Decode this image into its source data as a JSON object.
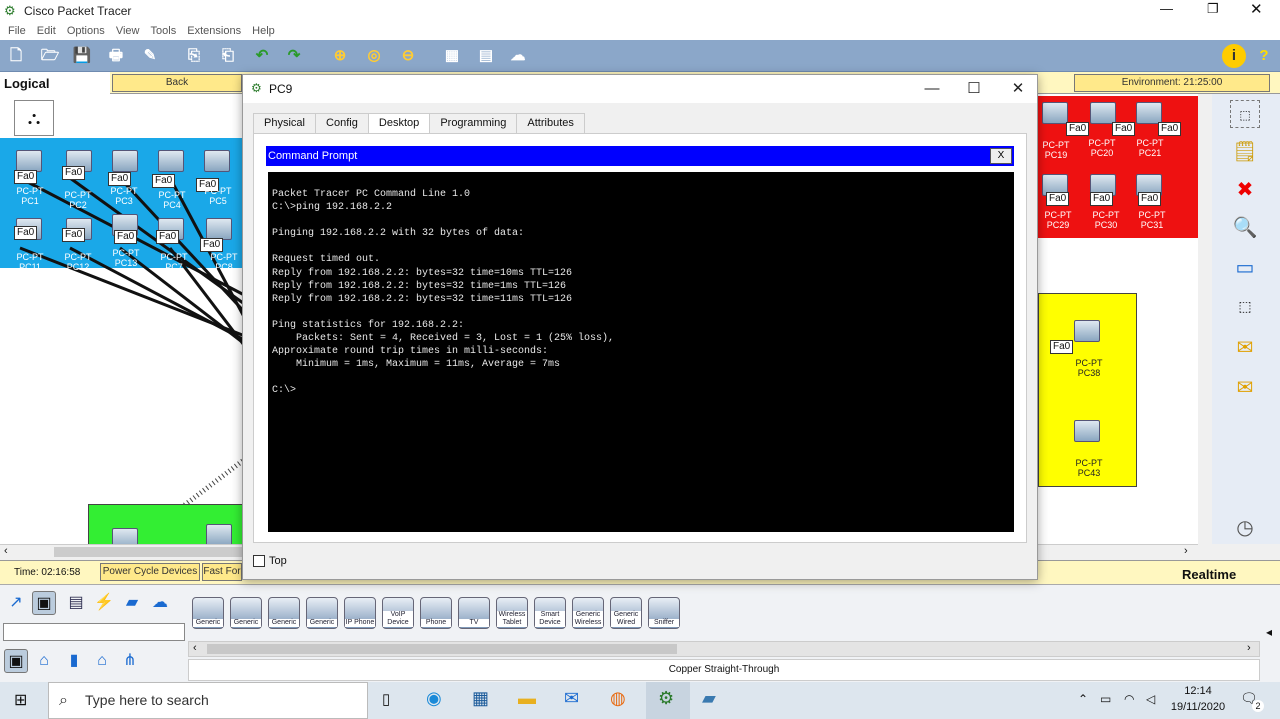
{
  "app": {
    "title": "Cisco Packet Tracer"
  },
  "menu": [
    "File",
    "Edit",
    "Options",
    "View",
    "Tools",
    "Extensions",
    "Help"
  ],
  "workspace": {
    "mode": "Logical",
    "back_label": "Back",
    "environment": "Environment: 21:25:00"
  },
  "canvas": {
    "blue_pcs": [
      {
        "label": "PC-PT",
        "name": "PC1"
      },
      {
        "label": "PC-PT",
        "name": "PC2"
      },
      {
        "label": "PC-PT",
        "name": "PC3"
      },
      {
        "label": "PC-PT",
        "name": "PC4"
      },
      {
        "label": "PC-PT",
        "name": "PC5"
      },
      {
        "label": "PC-PT",
        "name": "PC11"
      },
      {
        "label": "PC-PT",
        "name": "PC12"
      },
      {
        "label": "PC-PT",
        "name": "PC13"
      },
      {
        "label": "PC-PT",
        "name": "PC7"
      },
      {
        "label": "PC-PT",
        "name": "PC8"
      }
    ],
    "red_pcs": [
      {
        "label": "PC-PT",
        "name": "PC19"
      },
      {
        "label": "PC-PT",
        "name": "PC20"
      },
      {
        "label": "PC-PT",
        "name": "PC21"
      },
      {
        "label": "PC-PT",
        "name": "PC29"
      },
      {
        "label": "PC-PT",
        "name": "PC30"
      },
      {
        "label": "PC-PT",
        "name": "PC31"
      }
    ],
    "yellow_pcs": [
      {
        "label": "PC-PT",
        "name": "PC38"
      },
      {
        "label": "PC-PT",
        "name": "PC43"
      }
    ],
    "port_label": "Fa0"
  },
  "status": {
    "time": "Time: 02:16:58",
    "power_cycle": "Power Cycle Devices",
    "fast_forward": "Fast For",
    "mode": "Realtime"
  },
  "device_panel": {
    "devices": [
      {
        "label": "Generic"
      },
      {
        "label": "Generic"
      },
      {
        "label": "Generic"
      },
      {
        "label": "Generic"
      },
      {
        "label": "IP Phone"
      },
      {
        "label": "VoIP Device"
      },
      {
        "label": "Phone"
      },
      {
        "label": "TV"
      },
      {
        "label": "Wireless Tablet"
      },
      {
        "label": "Smart Device"
      },
      {
        "label": "Generic Wireless"
      },
      {
        "label": "Generic Wired"
      },
      {
        "label": "Sniffer"
      }
    ],
    "connection": "Copper Straight-Through"
  },
  "pc_window": {
    "title": "PC9",
    "tabs": [
      "Physical",
      "Config",
      "Desktop",
      "Programming",
      "Attributes"
    ],
    "active_tab": "Desktop",
    "cmd_title": "Command Prompt",
    "cmd_close": "X",
    "terminal": "Packet Tracer PC Command Line 1.0\nC:\\>ping 192.168.2.2\n\nPinging 192.168.2.2 with 32 bytes of data:\n\nRequest timed out.\nReply from 192.168.2.2: bytes=32 time=10ms TTL=126\nReply from 192.168.2.2: bytes=32 time=1ms TTL=126\nReply from 192.168.2.2: bytes=32 time=11ms TTL=126\n\nPing statistics for 192.168.2.2:\n    Packets: Sent = 4, Received = 3, Lost = 1 (25% loss),\nApproximate round trip times in milli-seconds:\n    Minimum = 1ms, Maximum = 11ms, Average = 7ms\n\nC:\\>",
    "top_label": "Top"
  },
  "taskbar": {
    "search_placeholder": "Type here to search",
    "time": "12:14",
    "date": "19/11/2020",
    "notifications": "2"
  }
}
